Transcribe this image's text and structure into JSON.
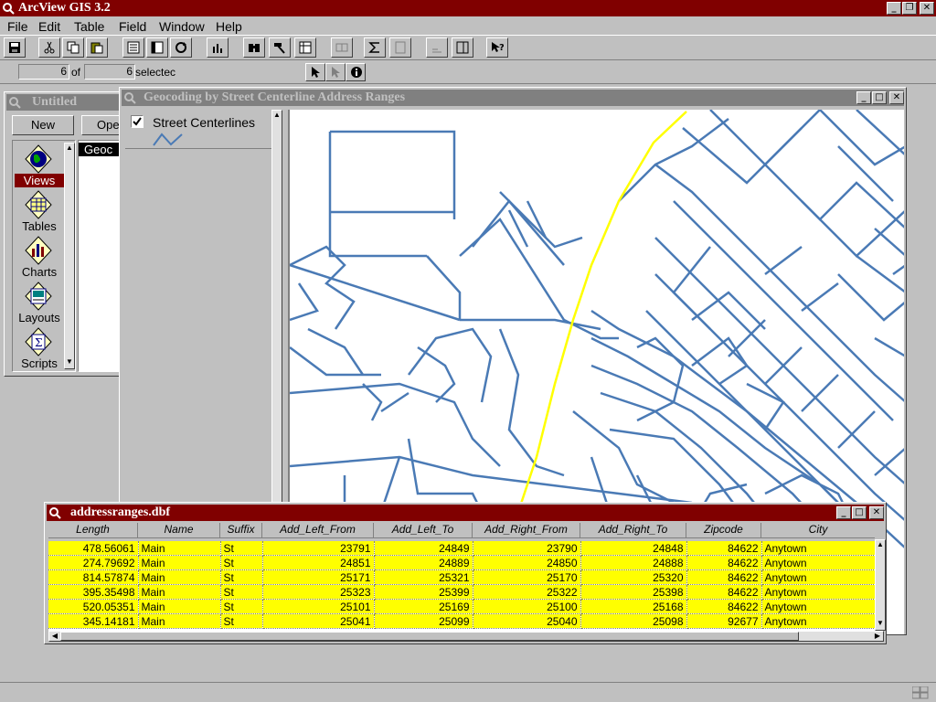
{
  "app": {
    "title": "ArcView GIS 3.2"
  },
  "menu": {
    "file": "File",
    "edit": "Edit",
    "table": "Table",
    "field": "Field",
    "window": "Window",
    "help": "Help"
  },
  "status": {
    "selected_count": "6",
    "of_label": "of",
    "total_count": "6",
    "selected_label": "selectec"
  },
  "project": {
    "title": "Untitled",
    "new_label": "New",
    "open_label": "Ope",
    "list_item": "Geoc",
    "icons": [
      {
        "label": "Views"
      },
      {
        "label": "Tables"
      },
      {
        "label": "Charts"
      },
      {
        "label": "Layouts"
      },
      {
        "label": "Scripts"
      }
    ]
  },
  "view": {
    "title": "Geocoding by Street Centerline Address Ranges",
    "layer_name": "Street Centerlines",
    "street_color": "#4a7ab5",
    "highlight_color": "#ffff00"
  },
  "table": {
    "title": "addressranges.dbf",
    "columns": [
      "Length",
      "Name",
      "Suffix",
      "Add_Left_From",
      "Add_Left_To",
      "Add_Right_From",
      "Add_Right_To",
      "Zipcode",
      "City"
    ],
    "rows": [
      [
        "478.56061",
        "Main",
        "St",
        "23791",
        "24849",
        "23790",
        "24848",
        "84622",
        "Anytown"
      ],
      [
        "274.79692",
        "Main",
        "St",
        "24851",
        "24889",
        "24850",
        "24888",
        "84622",
        "Anytown"
      ],
      [
        "814.57874",
        "Main",
        "St",
        "25171",
        "25321",
        "25170",
        "25320",
        "84622",
        "Anytown"
      ],
      [
        "395.35498",
        "Main",
        "St",
        "25323",
        "25399",
        "25322",
        "25398",
        "84622",
        "Anytown"
      ],
      [
        "520.05351",
        "Main",
        "St",
        "25101",
        "25169",
        "25100",
        "25168",
        "84622",
        "Anytown"
      ],
      [
        "345.14181",
        "Main",
        "St",
        "25041",
        "25099",
        "25040",
        "25098",
        "92677",
        "Anytown"
      ]
    ],
    "row_color": "#ffff00"
  }
}
